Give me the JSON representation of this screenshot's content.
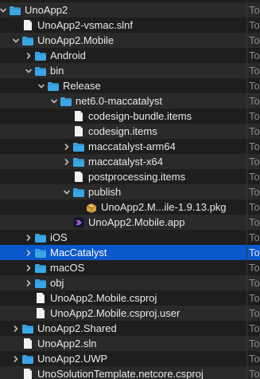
{
  "colors": {
    "background": "#1e1e1e",
    "alt_row": "#2a2a2a",
    "selection": "#0a58ca",
    "folder": "#3aa7e6",
    "text": "#e8e8e8",
    "kind_text": "#8a8a8a"
  },
  "rows": [
    {
      "name": "UnoApp2",
      "kind": "Tol",
      "type": "folder",
      "depth": 0,
      "chevron": "down"
    },
    {
      "name": "UnoApp2-vsmac.slnf",
      "kind": "Tol",
      "type": "file",
      "depth": 1,
      "chevron": "none"
    },
    {
      "name": "UnoApp2.Mobile",
      "kind": "Tol",
      "type": "folder",
      "depth": 1,
      "chevron": "down"
    },
    {
      "name": "Android",
      "kind": "Tol",
      "type": "folder",
      "depth": 2,
      "chevron": "right"
    },
    {
      "name": "bin",
      "kind": "Tol",
      "type": "folder",
      "depth": 2,
      "chevron": "down"
    },
    {
      "name": "Release",
      "kind": "Tol",
      "type": "folder",
      "depth": 3,
      "chevron": "down"
    },
    {
      "name": "net6.0-maccatalyst",
      "kind": "Tol",
      "type": "folder",
      "depth": 4,
      "chevron": "down"
    },
    {
      "name": "codesign-bundle.items",
      "kind": "Tol",
      "type": "file",
      "depth": 5,
      "chevron": "none"
    },
    {
      "name": "codesign.items",
      "kind": "Tol",
      "type": "file",
      "depth": 5,
      "chevron": "none"
    },
    {
      "name": "maccatalyst-arm64",
      "kind": "Tol",
      "type": "folder",
      "depth": 5,
      "chevron": "right"
    },
    {
      "name": "maccatalyst-x64",
      "kind": "Tol",
      "type": "folder",
      "depth": 5,
      "chevron": "right"
    },
    {
      "name": "postprocessing.items",
      "kind": "Tol",
      "type": "file",
      "depth": 5,
      "chevron": "none"
    },
    {
      "name": "publish",
      "kind": "Tol",
      "type": "folder",
      "depth": 5,
      "chevron": "down"
    },
    {
      "name": "UnoApp2.M...ile-1.9.13.pkg",
      "kind": "Tol",
      "type": "pkg",
      "depth": 6,
      "chevron": "none"
    },
    {
      "name": "UnoApp2.Mobile.app",
      "kind": "Tol",
      "type": "app",
      "depth": 5,
      "chevron": "none"
    },
    {
      "name": "iOS",
      "kind": "Tol",
      "type": "folder",
      "depth": 2,
      "chevron": "right"
    },
    {
      "name": "MacCatalyst",
      "kind": "Tol",
      "type": "folder",
      "depth": 2,
      "chevron": "right",
      "selected": true
    },
    {
      "name": "macOS",
      "kind": "Tol",
      "type": "folder",
      "depth": 2,
      "chevron": "right"
    },
    {
      "name": "obj",
      "kind": "Tol",
      "type": "folder",
      "depth": 2,
      "chevron": "right"
    },
    {
      "name": "UnoApp2.Mobile.csproj",
      "kind": "Tol",
      "type": "file",
      "depth": 2,
      "chevron": "none"
    },
    {
      "name": "UnoApp2.Mobile.csproj.user",
      "kind": "Tol",
      "type": "file",
      "depth": 2,
      "chevron": "none"
    },
    {
      "name": "UnoApp2.Shared",
      "kind": "Tol",
      "type": "folder",
      "depth": 1,
      "chevron": "right"
    },
    {
      "name": "UnoApp2.sln",
      "kind": "Tol",
      "type": "file",
      "depth": 1,
      "chevron": "none"
    },
    {
      "name": "UnoApp2.UWP",
      "kind": "Tol",
      "type": "folder",
      "depth": 1,
      "chevron": "right"
    },
    {
      "name": "UnoSolutionTemplate.netcore.csproj",
      "kind": "Tol",
      "type": "file",
      "depth": 1,
      "chevron": "none"
    }
  ]
}
